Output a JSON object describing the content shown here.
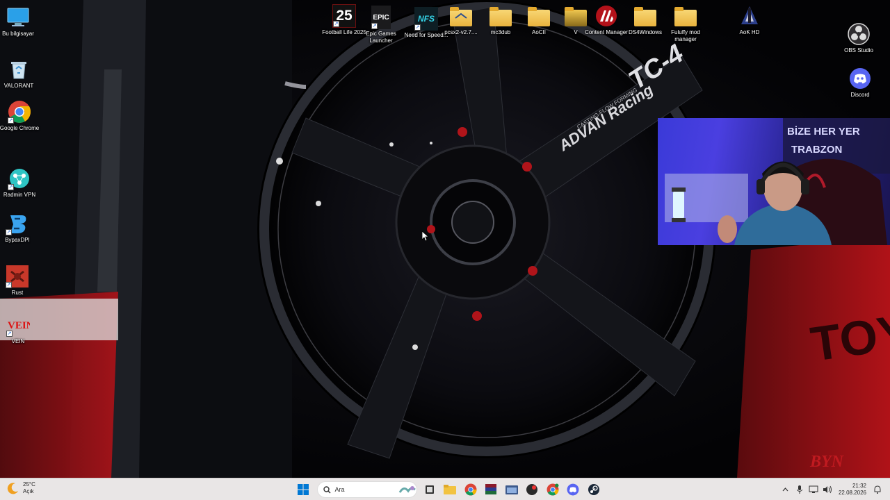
{
  "desktop_icons_left": [
    {
      "label": "Bu bilgisayar",
      "icon": "this-pc-monitor-icon"
    },
    {
      "label": "VALORANT",
      "icon": "recycle-bin-icon"
    },
    {
      "label": "Google Chrome",
      "icon": "chrome-icon"
    },
    {
      "label": "Radmin VPN",
      "icon": "radmin-vpn-icon"
    },
    {
      "label": "BypaxDPI",
      "icon": "bypaxdpi-icon"
    },
    {
      "label": "Rust",
      "icon": "rust-icon"
    },
    {
      "label": "VEIN",
      "icon": "vein-icon"
    }
  ],
  "desktop_icons_top": [
    {
      "label": "Football Life 2025",
      "icon_text": "25"
    },
    {
      "label": "Epic Games Launcher",
      "icon_text": "EPIC"
    },
    {
      "label": "Need for Speed...",
      "icon_text": "NFS"
    },
    {
      "label": "pcsx2-v2.7....",
      "icon": "folder-icon"
    },
    {
      "label": "mc3dub",
      "icon": "folder-icon"
    },
    {
      "label": "AoCII",
      "icon": "folder-icon"
    },
    {
      "label": "V",
      "icon": "folder-icon"
    },
    {
      "label": "Content Manager",
      "icon": "assetto-corsa-icon"
    },
    {
      "label": "DS4Windows",
      "icon": "folder-icon"
    },
    {
      "label": "Fuluffy mod manager",
      "icon": "folder-icon"
    },
    {
      "label": "AoK HD",
      "icon": "aok-hd-icon"
    }
  ],
  "desktop_icons_right": [
    {
      "label": "OBS Studio",
      "icon": "obs-icon"
    },
    {
      "label": "Discord",
      "icon": "discord-icon"
    }
  ],
  "wallpaper": {
    "brand_text": "ADVAN Racing",
    "sub_text": "CASTING-FLOW FORMING",
    "model_text": "TC-4",
    "side_text": "TOY",
    "signature": "BYN"
  },
  "webcam": {
    "banner_line1": "BİZE HER YER",
    "banner_line2": "TRABZON"
  },
  "taskbar": {
    "weather_temp": "25°C",
    "weather_desc": "Açık",
    "search_placeholder": "Ara",
    "time": "21:32",
    "date": "22.08.2026",
    "pinned": [
      "windows-start-icon",
      "task-view-icon",
      "file-explorer-icon",
      "chrome-icon",
      "winrar-icon",
      "folder-app-icon",
      "game-app-icon",
      "chrome-alt-icon",
      "discord-icon",
      "steam-icon"
    ]
  },
  "colors": {
    "taskbar_bg": "#e9e6e6",
    "folder_yellow": "#f0c34f",
    "discord_blurple": "#5865f2",
    "windows_blue": "#0078d4"
  }
}
